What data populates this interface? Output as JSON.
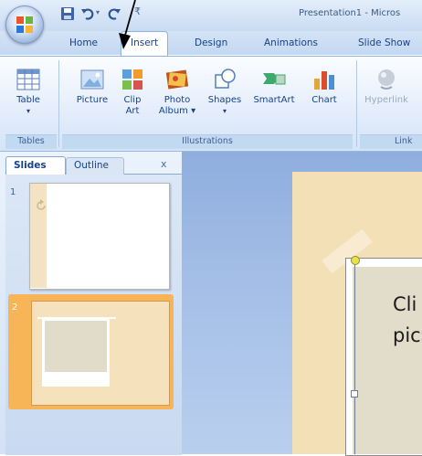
{
  "window": {
    "title": "Presentation1 - Micros"
  },
  "tabs": [
    {
      "label": "Home"
    },
    {
      "label": "Insert"
    },
    {
      "label": "Design"
    },
    {
      "label": "Animations"
    },
    {
      "label": "Slide Show"
    }
  ],
  "ribbon": {
    "groups": {
      "tables": "Tables",
      "illustrations": "Illustrations",
      "links": "Link"
    },
    "buttons": {
      "table": {
        "line1": "Table",
        "line2": "▾"
      },
      "picture": {
        "line1": "Picture",
        "line2": ""
      },
      "clipart": {
        "line1": "Clip",
        "line2": "Art"
      },
      "photoalbum": {
        "line1": "Photo",
        "line2": "Album ▾"
      },
      "shapes": {
        "line1": "Shapes",
        "line2": "▾"
      },
      "smartart": {
        "line1": "SmartArt",
        "line2": ""
      },
      "chart": {
        "line1": "Chart",
        "line2": ""
      },
      "hyperlink": {
        "line1": "Hyperlink",
        "line2": ""
      }
    }
  },
  "pane": {
    "tabs": {
      "slides": "Slides",
      "outline": "Outline"
    },
    "close": "x",
    "slides": [
      {
        "number": "1",
        "selected": false
      },
      {
        "number": "2",
        "selected": true
      }
    ]
  },
  "main_slide": {
    "text_line1": "Cli",
    "text_line2": "pic"
  },
  "colors": {
    "ribbon_text": "#15428b",
    "selected_slide": "#f7b557",
    "slide_background": "#f4e0b7"
  }
}
